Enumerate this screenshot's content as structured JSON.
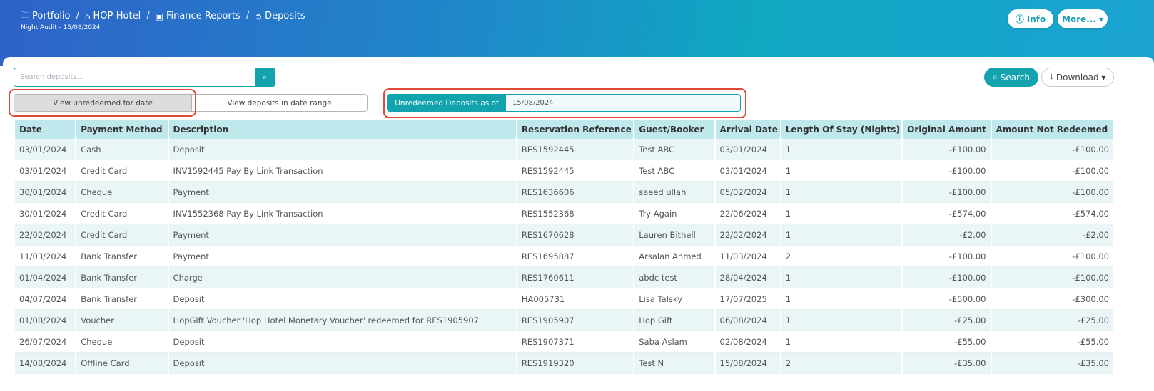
{
  "breadcrumb": [
    {
      "icon": "folder-icon",
      "glyph": "🗀",
      "label": "Portfolio"
    },
    {
      "icon": "home-icon",
      "glyph": "⌂",
      "label": "HOP-Hotel"
    },
    {
      "icon": "money-icon",
      "glyph": "▣",
      "label": "Finance Reports"
    },
    {
      "icon": "arrow-circle-icon",
      "glyph": "➲",
      "label": "Deposits"
    }
  ],
  "header": {
    "subtitle": "Night Audit - 15/08/2024",
    "info_label": "Info",
    "more_label": "More... ▾"
  },
  "search": {
    "placeholder": "Search deposits..."
  },
  "actions": {
    "search_label": "Search",
    "download_label": "Download ▾"
  },
  "toggle": {
    "unredeemed_label": "View unredeemed for date",
    "range_label": "View deposits in date range"
  },
  "date_filter": {
    "label": "Unredeemed Deposits as of",
    "value": "15/08/2024"
  },
  "table": {
    "columns": [
      "Date",
      "Payment Method",
      "Description",
      "Reservation Reference",
      "Guest/Booker",
      "Arrival Date",
      "Length Of Stay (Nights)",
      "Original Amount",
      "Amount Not Redeemed"
    ],
    "rows": [
      [
        "03/01/2024",
        "Cash",
        "Deposit",
        "RES1592445",
        "Test ABC",
        "03/01/2024",
        "1",
        "-£100.00",
        "-£100.00"
      ],
      [
        "03/01/2024",
        "Credit Card",
        "INV1592445 Pay By Link Transaction",
        "RES1592445",
        "Test ABC",
        "03/01/2024",
        "1",
        "-£100.00",
        "-£100.00"
      ],
      [
        "30/01/2024",
        "Cheque",
        "Payment",
        "RES1636606",
        "saeed ullah",
        "05/02/2024",
        "1",
        "-£100.00",
        "-£100.00"
      ],
      [
        "30/01/2024",
        "Credit Card",
        "INV1552368 Pay By Link Transaction",
        "RES1552368",
        "Try Again",
        "22/06/2024",
        "1",
        "-£574.00",
        "-£574.00"
      ],
      [
        "22/02/2024",
        "Credit Card",
        "Payment",
        "RES1670628",
        "Lauren Bithell",
        "22/02/2024",
        "1",
        "-£2.00",
        "-£2.00"
      ],
      [
        "11/03/2024",
        "Bank Transfer",
        "Payment",
        "RES1695887",
        "Arsalan Ahmed",
        "11/03/2024",
        "2",
        "-£100.00",
        "-£100.00"
      ],
      [
        "01/04/2024",
        "Bank Transfer",
        "Charge",
        "RES1760611",
        "abdc test",
        "28/04/2024",
        "1",
        "-£100.00",
        "-£100.00"
      ],
      [
        "04/07/2024",
        "Bank Transfer",
        "Deposit",
        "HA005731",
        "Lisa Talsky",
        "17/07/2025",
        "1",
        "-£500.00",
        "-£300.00"
      ],
      [
        "01/08/2024",
        "Voucher",
        "HopGift Voucher 'Hop Hotel Monetary Voucher' redeemed for RES1905907",
        "RES1905907",
        "Hop Gift",
        "06/08/2024",
        "1",
        "-£25.00",
        "-£25.00"
      ],
      [
        "26/07/2024",
        "Cheque",
        "Deposit",
        "RES1907371",
        "Saba Aslam",
        "02/08/2024",
        "1",
        "-£55.00",
        "-£55.00"
      ],
      [
        "14/08/2024",
        "Offline Card",
        "Deposit",
        "RES1919320",
        "Test N",
        "15/08/2024",
        "2",
        "-£35.00",
        "-£35.00"
      ]
    ]
  },
  "colors": {
    "accent": "#13a3ae",
    "header_gradient_start": "#2f62c9",
    "header_gradient_end": "#1ba3d1",
    "highlight": "#e04b38"
  }
}
